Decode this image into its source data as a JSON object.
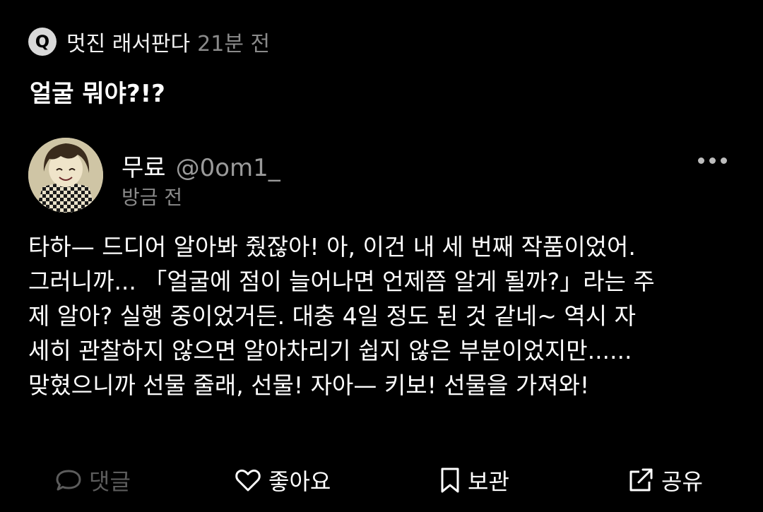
{
  "question": {
    "badge": "Q",
    "author": "멋진 래서판다",
    "time": "21분 전",
    "title": "얼굴 뭐야?!?"
  },
  "post": {
    "display_name": "무료",
    "handle": "@0om1_",
    "time": "방금 전",
    "body_lines": [
      "타하— 드디어 알아봐 줬잖아! 아, 이건 내 세 번째 작품이었어.",
      "그러니까... 「얼굴에 점이 늘어나면 언제쯤 알게 될까?」라는 주",
      "제 알아? 실행 중이었거든. 대충 4일 정도 된 것 같네~ 역시 자",
      "세히 관찰하지 않으면 알아차리기 쉽지 않은 부분이었지만......",
      "맞혔으니까 선물 줄래, 선물! 자아— 키보! 선물을 가져와!"
    ]
  },
  "actions": {
    "comment": "댓글",
    "like": "좋아요",
    "save": "보관",
    "share": "공유"
  },
  "icons": {
    "more": "more-dots-icon",
    "comment": "speech-bubble-icon",
    "like": "heart-icon",
    "save": "bookmark-icon",
    "share": "share-icon"
  },
  "colors": {
    "background": "#000000",
    "text": "#ffffff",
    "muted": "#8a8a8a",
    "disabled": "#5c5c5c",
    "badge": "#d9d9d9"
  }
}
